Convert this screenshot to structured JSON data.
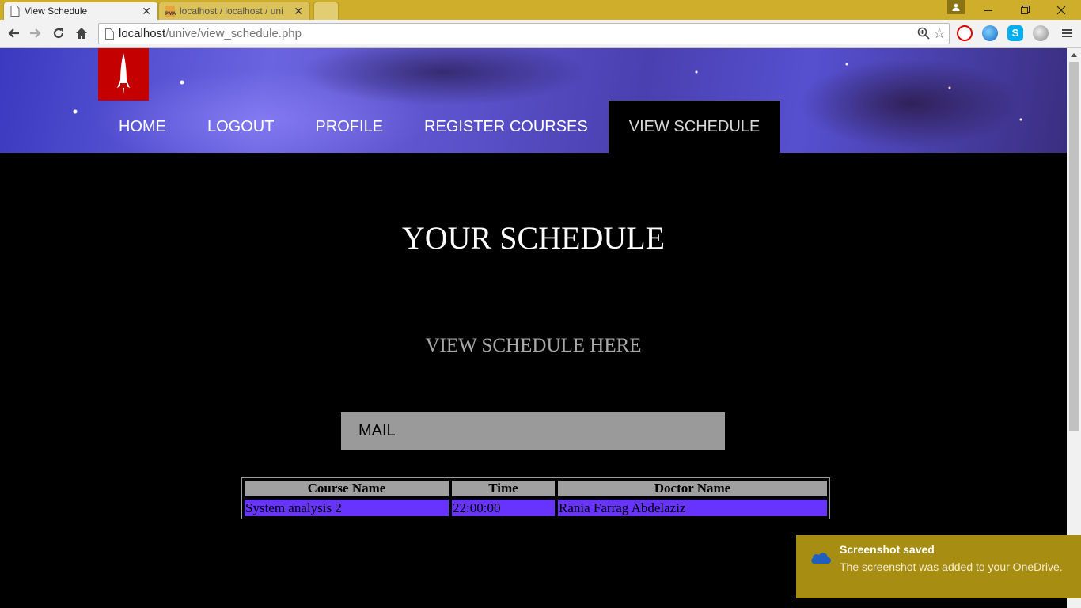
{
  "browser": {
    "tabs": [
      {
        "label": "View Schedule",
        "active": true
      },
      {
        "label": "localhost / localhost / uni",
        "active": false,
        "favicon_text": "PMA"
      }
    ],
    "url": {
      "host": "localhost",
      "path": "/unive/view_schedule.php"
    }
  },
  "site": {
    "nav": [
      {
        "label": "HOME"
      },
      {
        "label": "LOGOUT"
      },
      {
        "label": "PROFILE"
      },
      {
        "label": "REGISTER COURSES"
      },
      {
        "label": "VIEW SCHEDULE",
        "active": true
      }
    ]
  },
  "main": {
    "title": "YOUR SCHEDULE",
    "subtitle": "VIEW SCHEDULE HERE",
    "mail_label": "MAIL"
  },
  "schedule": {
    "headers": [
      "Course Name",
      "Time",
      "Doctor Name"
    ],
    "rows": [
      [
        "System analysis 2",
        "22:00:00",
        "Rania Farrag Abdelaziz"
      ]
    ]
  },
  "notification": {
    "title": "Screenshot saved",
    "body": "The screenshot was added to your OneDrive."
  },
  "colors": {
    "titlebar": "#cfae2b",
    "logo_red": "#c40000",
    "table_header": "#a0a0a0",
    "table_row": "#6633ff",
    "mail_box": "#9a9a9a",
    "toast": "#a78e12"
  },
  "icons": [
    "page-icon",
    "close-icon",
    "back-icon",
    "forward-icon",
    "reload-icon",
    "home-icon",
    "zoom-icon",
    "star-icon",
    "menu-icon",
    "onedrive-cloud-icon",
    "rocket-logo-icon"
  ]
}
